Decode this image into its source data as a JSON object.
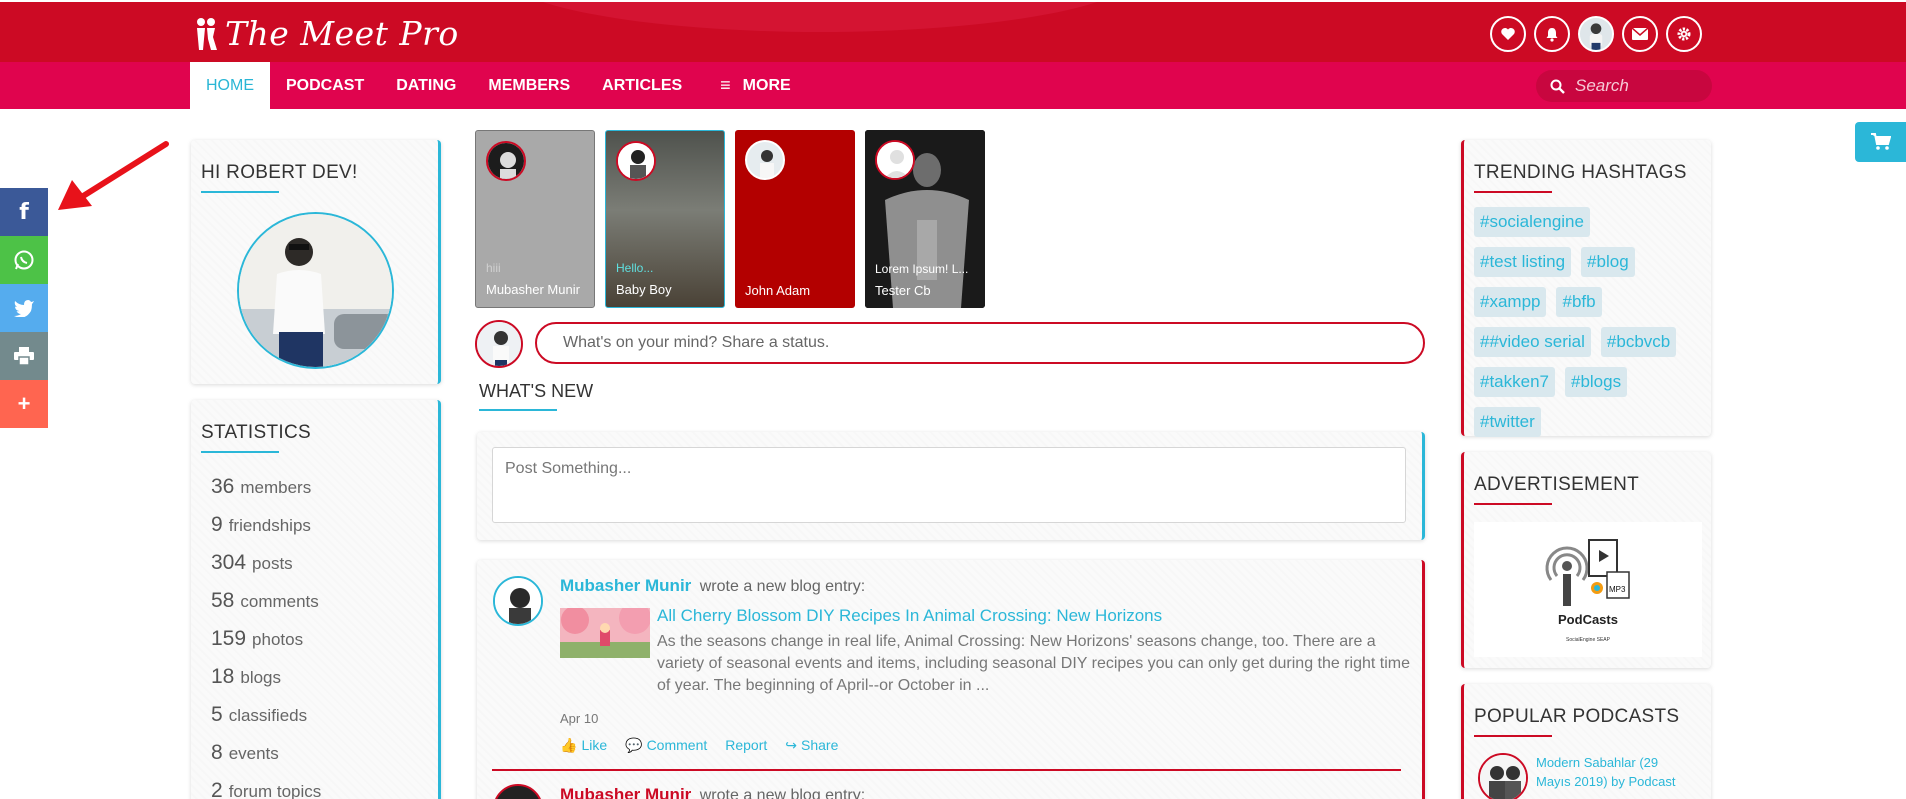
{
  "header": {
    "logo_text": "The Meet Pro",
    "icons": [
      "heart-icon",
      "bell-icon",
      "user-avatar",
      "envelope-icon",
      "gear-icon"
    ]
  },
  "nav": {
    "items": [
      {
        "label": "HOME",
        "active": true
      },
      {
        "label": "PODCAST",
        "active": false
      },
      {
        "label": "DATING",
        "active": false
      },
      {
        "label": "MEMBERS",
        "active": false
      },
      {
        "label": "ARTICLES",
        "active": false
      },
      {
        "label": "MORE",
        "active": false
      }
    ],
    "search_placeholder": "Search"
  },
  "share_bar": [
    {
      "icon": "facebook-icon",
      "glyph": "f",
      "color": "#3b5998"
    },
    {
      "icon": "whatsapp-icon",
      "glyph": "✆",
      "color": "#4dc247"
    },
    {
      "icon": "twitter-icon",
      "glyph": "🐦",
      "color": "#55acee"
    },
    {
      "icon": "print-icon",
      "glyph": "⎙",
      "color": "#738a8d"
    },
    {
      "icon": "more-icon",
      "glyph": "+",
      "color": "#ff6550"
    }
  ],
  "left": {
    "greeting": "HI ROBERT DEV!",
    "statistics_title": "STATISTICS",
    "stats": [
      {
        "num": "36",
        "label": "members"
      },
      {
        "num": "9",
        "label": "friendships"
      },
      {
        "num": "304",
        "label": "posts"
      },
      {
        "num": "58",
        "label": "comments"
      },
      {
        "num": "159",
        "label": "photos"
      },
      {
        "num": "18",
        "label": "blogs"
      },
      {
        "num": "5",
        "label": "classifieds"
      },
      {
        "num": "8",
        "label": "events"
      },
      {
        "num": "2",
        "label": "forum topics"
      }
    ]
  },
  "stories": [
    {
      "text": "hiii",
      "name": "Mubasher Munir",
      "bg": "#a9a9a9",
      "text_color": "#d0d0d0"
    },
    {
      "text": "Hello...",
      "name": "Baby Boy",
      "bg": "#5a5d57",
      "text_color": "#5fe0e0"
    },
    {
      "text": "",
      "name": "John Adam",
      "bg": "#b30000",
      "text_color": "#ffffff"
    },
    {
      "text": "Lorem Ipsum! L...",
      "name": "Tester Cb",
      "bg": "#202020",
      "text_color": "#ffffff"
    }
  ],
  "status_placeholder": "What's on your mind? Share a status.",
  "whats_new_title": "WHAT'S NEW",
  "composer_placeholder": "Post Something...",
  "feed": {
    "author": "Mubasher Munir",
    "action": "wrote a new blog entry:",
    "title": "All Cherry Blossom DIY Recipes In Animal Crossing: New Horizons",
    "body": "As the seasons change in real life, Animal Crossing: New Horizons' seasons change, too. There are a variety of seasonal events and items, including seasonal DIY recipes you can only get during the right time of year. The beginning of April--or October in ...",
    "date": "Apr 10",
    "actions": [
      "Like",
      "Comment",
      "Report",
      "Share"
    ],
    "next_author": "Mubasher Munir",
    "next_action": "wrote a new blog entry:"
  },
  "right": {
    "hashtags_title": "TRENDING HASHTAGS",
    "hashtags": [
      "#socialengine",
      "#test listing",
      "#blog",
      "#xampp",
      "#bfb",
      "##video serial",
      "#bcbvcb",
      "#takken7",
      "#blogs",
      "#twitter"
    ],
    "ad_title": "ADVERTISEMENT",
    "ad_label": "PodCasts",
    "ad_sub": "SocialEngine SEAP",
    "ad_mp3": "MP3",
    "podcasts_title": "POPULAR PODCASTS",
    "podcast_item": "Modern Sabahlar (29 Mayıs 2019) by Podcast"
  },
  "colors": {
    "header_red": "#cc0a24",
    "nav_pink": "#e0044e",
    "accent_cyan": "#2bb7d8"
  }
}
